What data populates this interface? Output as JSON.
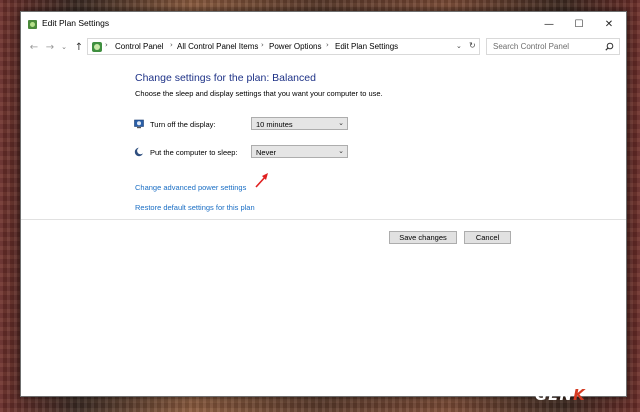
{
  "window": {
    "title": "Edit Plan Settings",
    "controls": {
      "minimize": "—",
      "maximize": "☐",
      "close": "✕"
    }
  },
  "address": {
    "breadcrumb": [
      "Control Panel",
      "All Control Panel Items",
      "Power Options",
      "Edit Plan Settings"
    ],
    "search_placeholder": "Search Control Panel"
  },
  "main": {
    "heading": "Change settings for the plan: Balanced",
    "subheading": "Choose the sleep and display settings that you want your computer to use.",
    "settings": [
      {
        "label": "Turn off the display:",
        "value": "10 minutes",
        "icon": "monitor-icon"
      },
      {
        "label": "Put the computer to sleep:",
        "value": "Never",
        "icon": "moon-icon"
      }
    ],
    "links": [
      "Change advanced power settings",
      "Restore default settings for this plan"
    ],
    "buttons": {
      "save": "Save changes",
      "cancel": "Cancel"
    }
  },
  "watermark": {
    "text": "GEN",
    "accent": "K"
  },
  "colors": {
    "heading": "#1e3287",
    "link": "#1a6ec4",
    "arrow": "#e02020",
    "accent": "#d43a22"
  }
}
